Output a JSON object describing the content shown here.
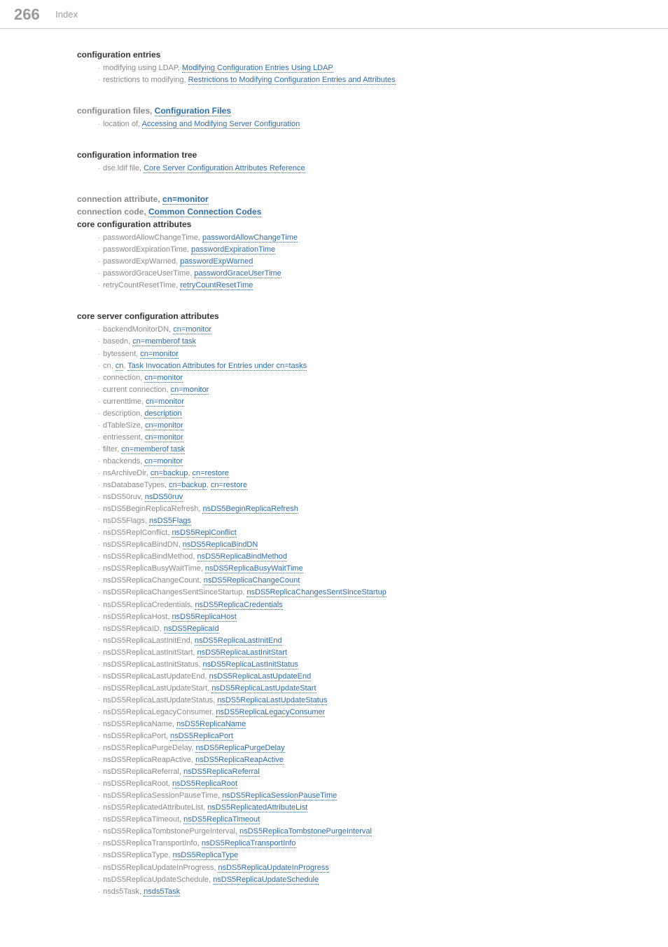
{
  "header": {
    "page_number": "266",
    "title": "Index"
  },
  "section_config_entries": {
    "heading": "configuration entries",
    "items": [
      {
        "pre": "modifying using LDAP, ",
        "link": "Modifying Configuration Entries Using LDAP"
      },
      {
        "pre": "restrictions to modifying, ",
        "link": "Restrictions to Modifying Configuration Entries and Attributes"
      }
    ]
  },
  "section_config_files": {
    "heading_plain": "configuration files, ",
    "heading_link": "Configuration Files",
    "items": [
      {
        "pre": "location of, ",
        "link": "Accessing and Modifying Server Configuration"
      }
    ]
  },
  "section_config_info_tree": {
    "heading": "configuration information tree",
    "items": [
      {
        "pre": "dse.ldif file, ",
        "link": "Core Server Configuration Attributes Reference"
      }
    ]
  },
  "section_conn_attr": {
    "heading_plain": "connection attribute, ",
    "heading_link": "cn=monitor"
  },
  "section_conn_code": {
    "heading_plain": "connection code, ",
    "heading_link": "Common Connection Codes"
  },
  "section_core_config_attrs": {
    "heading": "core configuration attributes",
    "items": [
      {
        "pre": "passwordAllowChangeTime, ",
        "link": "passwordAllowChangeTime"
      },
      {
        "pre": "passwordExpirationTime, ",
        "link": "passwordExpirationTime"
      },
      {
        "pre": "passwordExpWarned, ",
        "link": "passwordExpWarned"
      },
      {
        "pre": "passwordGraceUserTime, ",
        "link": "passwordGraceUserTime"
      },
      {
        "pre": "retryCountResetTime, ",
        "link": "retryCountResetTime"
      }
    ]
  },
  "section_core_server_config_attrs": {
    "heading": "core server configuration attributes",
    "items": [
      {
        "pre": "backendMonitorDN, ",
        "links": [
          "cn=monitor"
        ]
      },
      {
        "pre": "basedn, ",
        "links": [
          "cn=memberof task"
        ]
      },
      {
        "pre": "bytessent, ",
        "links": [
          "cn=monitor"
        ]
      },
      {
        "pre": "cn, ",
        "links": [
          "cn",
          "Task Invocation Attributes for Entries under cn=tasks"
        ]
      },
      {
        "pre": "connection, ",
        "links": [
          "cn=monitor"
        ]
      },
      {
        "pre": "current connection, ",
        "links": [
          "cn=monitor"
        ]
      },
      {
        "pre": "currenttime, ",
        "links": [
          "cn=monitor"
        ]
      },
      {
        "pre": "description, ",
        "links": [
          "description"
        ]
      },
      {
        "pre": "dTableSize, ",
        "links": [
          "cn=monitor"
        ]
      },
      {
        "pre": "entriessent, ",
        "links": [
          "cn=monitor"
        ]
      },
      {
        "pre": "filter, ",
        "links": [
          "cn=memberof task"
        ]
      },
      {
        "pre": "nbackends, ",
        "links": [
          "cn=monitor"
        ]
      },
      {
        "pre": "nsArchiveDir, ",
        "links": [
          "cn=backup",
          "cn=restore"
        ]
      },
      {
        "pre": "nsDatabaseTypes, ",
        "links": [
          "cn=backup",
          "cn=restore"
        ]
      },
      {
        "pre": "nsDS50ruv, ",
        "links": [
          "nsDS50ruv"
        ]
      },
      {
        "pre": "nsDS5BeginReplicaRefresh, ",
        "links": [
          "nsDS5BeginReplicaRefresh"
        ]
      },
      {
        "pre": "nsDS5Flags, ",
        "links": [
          "nsDS5Flags"
        ]
      },
      {
        "pre": "nsDS5ReplConflict, ",
        "links": [
          "nsDS5ReplConflict"
        ]
      },
      {
        "pre": "nsDS5ReplicaBindDN, ",
        "links": [
          "nsDS5ReplicaBindDN"
        ]
      },
      {
        "pre": "nsDS5ReplicaBindMethod, ",
        "links": [
          "nsDS5ReplicaBindMethod"
        ]
      },
      {
        "pre": "nsDS5ReplicaBusyWaitTime, ",
        "links": [
          "nsDS5ReplicaBusyWaitTime"
        ]
      },
      {
        "pre": "nsDS5ReplicaChangeCount, ",
        "links": [
          "nsDS5ReplicaChangeCount"
        ]
      },
      {
        "pre": "nsDS5ReplicaChangesSentSinceStartup, ",
        "links": [
          "nsDS5ReplicaChangesSentSinceStartup"
        ]
      },
      {
        "pre": "nsDS5ReplicaCredentials, ",
        "links": [
          "nsDS5ReplicaCredentials"
        ]
      },
      {
        "pre": "nsDS5ReplicaHost, ",
        "links": [
          "nsDS5ReplicaHost"
        ]
      },
      {
        "pre": "nsDS5ReplicaID, ",
        "links": [
          "nsDS5ReplicaId"
        ]
      },
      {
        "pre": "nsDS5ReplicaLastInitEnd, ",
        "links": [
          "nsDS5ReplicaLastInitEnd"
        ]
      },
      {
        "pre": "nsDS5ReplicaLastInitStart, ",
        "links": [
          "nsDS5ReplicaLastInitStart"
        ]
      },
      {
        "pre": "nsDS5ReplicaLastInitStatus, ",
        "links": [
          "nsDS5ReplicaLastInitStatus"
        ]
      },
      {
        "pre": "nsDS5ReplicaLastUpdateEnd, ",
        "links": [
          "nsDS5ReplicaLastUpdateEnd"
        ]
      },
      {
        "pre": "nsDS5ReplicaLastUpdateStart, ",
        "links": [
          "nsDS5ReplicaLastUpdateStart"
        ]
      },
      {
        "pre": "nsDS5ReplicaLastUpdateStatus, ",
        "links": [
          "nsDS5ReplicaLastUpdateStatus"
        ]
      },
      {
        "pre": "nsDS5ReplicaLegacyConsumer, ",
        "links": [
          "nsDS5ReplicaLegacyConsumer"
        ]
      },
      {
        "pre": "nsDS5ReplicaName, ",
        "links": [
          "nsDS5ReplicaName"
        ]
      },
      {
        "pre": "nsDS5ReplicaPort, ",
        "links": [
          "nsDS5ReplicaPort"
        ]
      },
      {
        "pre": "nsDS5ReplicaPurgeDelay, ",
        "links": [
          "nsDS5ReplicaPurgeDelay"
        ]
      },
      {
        "pre": "nsDS5ReplicaReapActive, ",
        "links": [
          "nsDS5ReplicaReapActive"
        ]
      },
      {
        "pre": "nsDS5ReplicaReferral, ",
        "links": [
          "nsDS5ReplicaReferral"
        ]
      },
      {
        "pre": "nsDS5ReplicaRoot, ",
        "links": [
          "nsDS5ReplicaRoot"
        ]
      },
      {
        "pre": "nsDS5ReplicaSessionPauseTime, ",
        "links": [
          "nsDS5ReplicaSessionPauseTime"
        ]
      },
      {
        "pre": "nsDS5ReplicatedAttributeList, ",
        "links": [
          "nsDS5ReplicatedAttributeList"
        ]
      },
      {
        "pre": "nsDS5ReplicaTimeout, ",
        "links": [
          "nsDS5ReplicaTimeout"
        ]
      },
      {
        "pre": "nsDS5ReplicaTombstonePurgeInterval, ",
        "links": [
          "nsDS5ReplicaTombstonePurgeInterval"
        ]
      },
      {
        "pre": "nsDS5ReplicaTransportInfo, ",
        "links": [
          "nsDS5ReplicaTransportInfo"
        ]
      },
      {
        "pre": "nsDS5ReplicaType, ",
        "links": [
          "nsDS5ReplicaType"
        ]
      },
      {
        "pre": "nsDS5ReplicaUpdateInProgress, ",
        "links": [
          "nsDS5ReplicaUpdateInProgress"
        ]
      },
      {
        "pre": "nsDS5ReplicaUpdateSchedule, ",
        "links": [
          "nsDS5ReplicaUpdateSchedule"
        ]
      },
      {
        "pre": "nsds5Task, ",
        "links": [
          "nsds5Task"
        ]
      }
    ]
  }
}
